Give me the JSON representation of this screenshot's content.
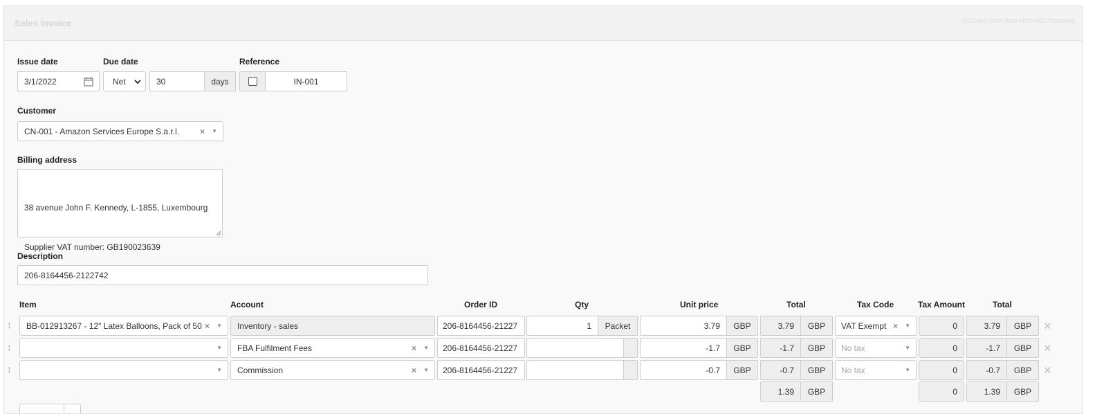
{
  "panel": {
    "title": "Sales Invoice",
    "guid": "f5033a50-01df-488b-b00f-4d5278a3dee6"
  },
  "fields": {
    "issue_date_label": "Issue date",
    "issue_date_value": "3/1/2022",
    "due_date_label": "Due date",
    "due_date_type": "Net",
    "due_date_days": "30",
    "due_date_unit": "days",
    "reference_label": "Reference",
    "reference_value": "IN-001",
    "customer_label": "Customer",
    "customer_value": "CN-001 - Amazon Services Europe S.a.r.l.",
    "billing_label": "Billing address",
    "billing_line1": "38 avenue John F. Kennedy, L-1855, Luxembourg",
    "billing_line2": "Supplier VAT number: GB190023639",
    "description_label": "Description",
    "description_value": "206-8164456-2122742"
  },
  "table": {
    "headers": {
      "item": "Item",
      "account": "Account",
      "order_id": "Order ID",
      "qty": "Qty",
      "unit_price": "Unit price",
      "total": "Total",
      "tax_code": "Tax Code",
      "tax_amount": "Tax Amount",
      "total2": "Total"
    },
    "currency": "GBP",
    "rows": [
      {
        "item": "BB-012913267 - 12\" Latex Balloons, Pack of 50",
        "account": "Inventory - sales",
        "order_id": "206-8164456-21227",
        "qty": "1",
        "unit": "Packet",
        "unit_price": "3.79",
        "total": "3.79",
        "tax_code": "VAT Exempt",
        "tax_amount": "0",
        "total2": "3.79"
      },
      {
        "item": "",
        "account": "FBA Fulfilment Fees",
        "order_id": "206-8164456-21227",
        "qty": "",
        "unit": "",
        "unit_price": "-1.7",
        "total": "-1.7",
        "tax_code": "No tax",
        "tax_amount": "0",
        "total2": "-1.7"
      },
      {
        "item": "",
        "account": "Commission",
        "order_id": "206-8164456-21227",
        "qty": "",
        "unit": "",
        "unit_price": "-0.7",
        "total": "-0.7",
        "tax_code": "No tax",
        "tax_amount": "0",
        "total2": "-0.7"
      }
    ],
    "footer": {
      "total": "1.39",
      "tax_amount": "0",
      "total2": "1.39"
    }
  },
  "icons": {
    "calendar": "calendar-icon",
    "clear": "clear-icon",
    "caret": "caret-down-icon",
    "drag": "drag-handle-icon",
    "remove": "remove-row-icon"
  }
}
